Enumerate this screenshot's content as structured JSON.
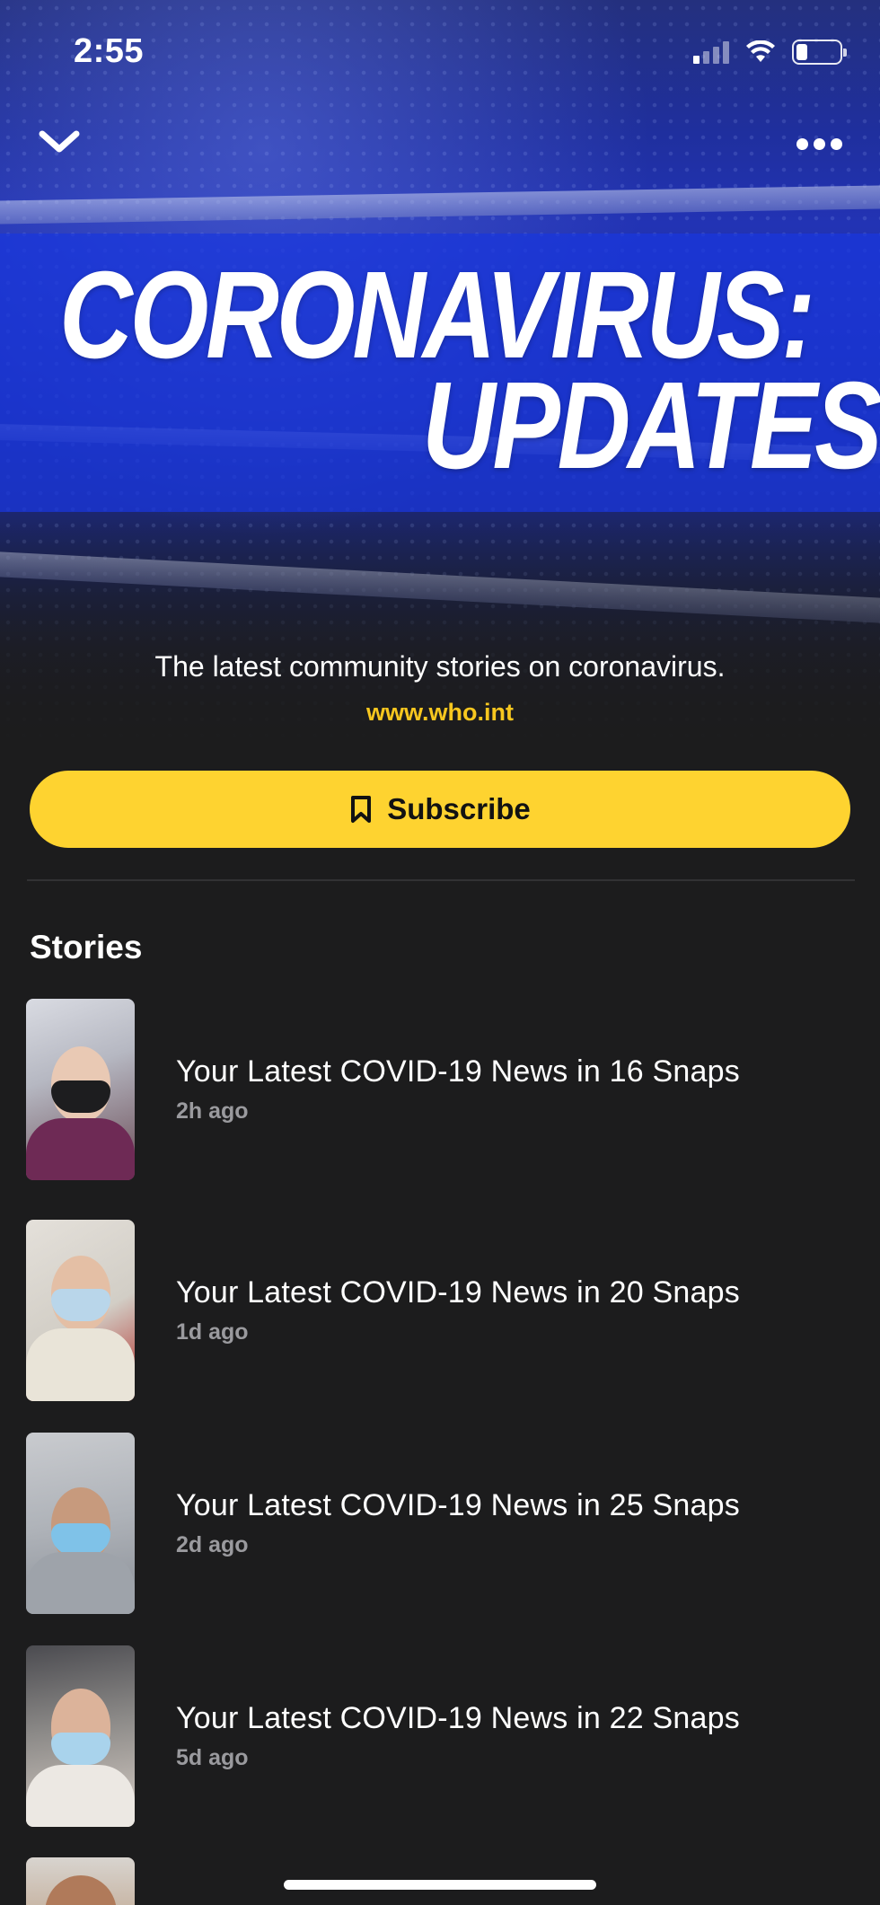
{
  "status_bar": {
    "time": "2:55"
  },
  "header": {
    "headline_line1": "CORONAVIRUS:",
    "headline_line2": "UPDATES",
    "description": "The latest community stories on coronavirus.",
    "website": "www.who.int"
  },
  "actions": {
    "subscribe_label": "Subscribe"
  },
  "stories_section": {
    "title": "Stories",
    "items": [
      {
        "title": "Your Latest COVID-19 News in 16 Snaps",
        "time": "2h ago"
      },
      {
        "title": "Your Latest COVID-19 News in 20 Snaps",
        "time": "1d ago"
      },
      {
        "title": "Your Latest COVID-19 News in 25 Snaps",
        "time": "2d ago"
      },
      {
        "title": "Your Latest COVID-19 News in 22 Snaps",
        "time": "5d ago"
      }
    ]
  },
  "icons": [
    "chevron-down-icon",
    "more-options-icon",
    "bookmark-icon",
    "signal-icon",
    "wifi-icon",
    "battery-icon"
  ],
  "colors": {
    "accent_yellow": "#fed330",
    "link_yellow": "#f7c71f",
    "background": "#1c1c1d",
    "hero_blue": "#2233b4"
  }
}
